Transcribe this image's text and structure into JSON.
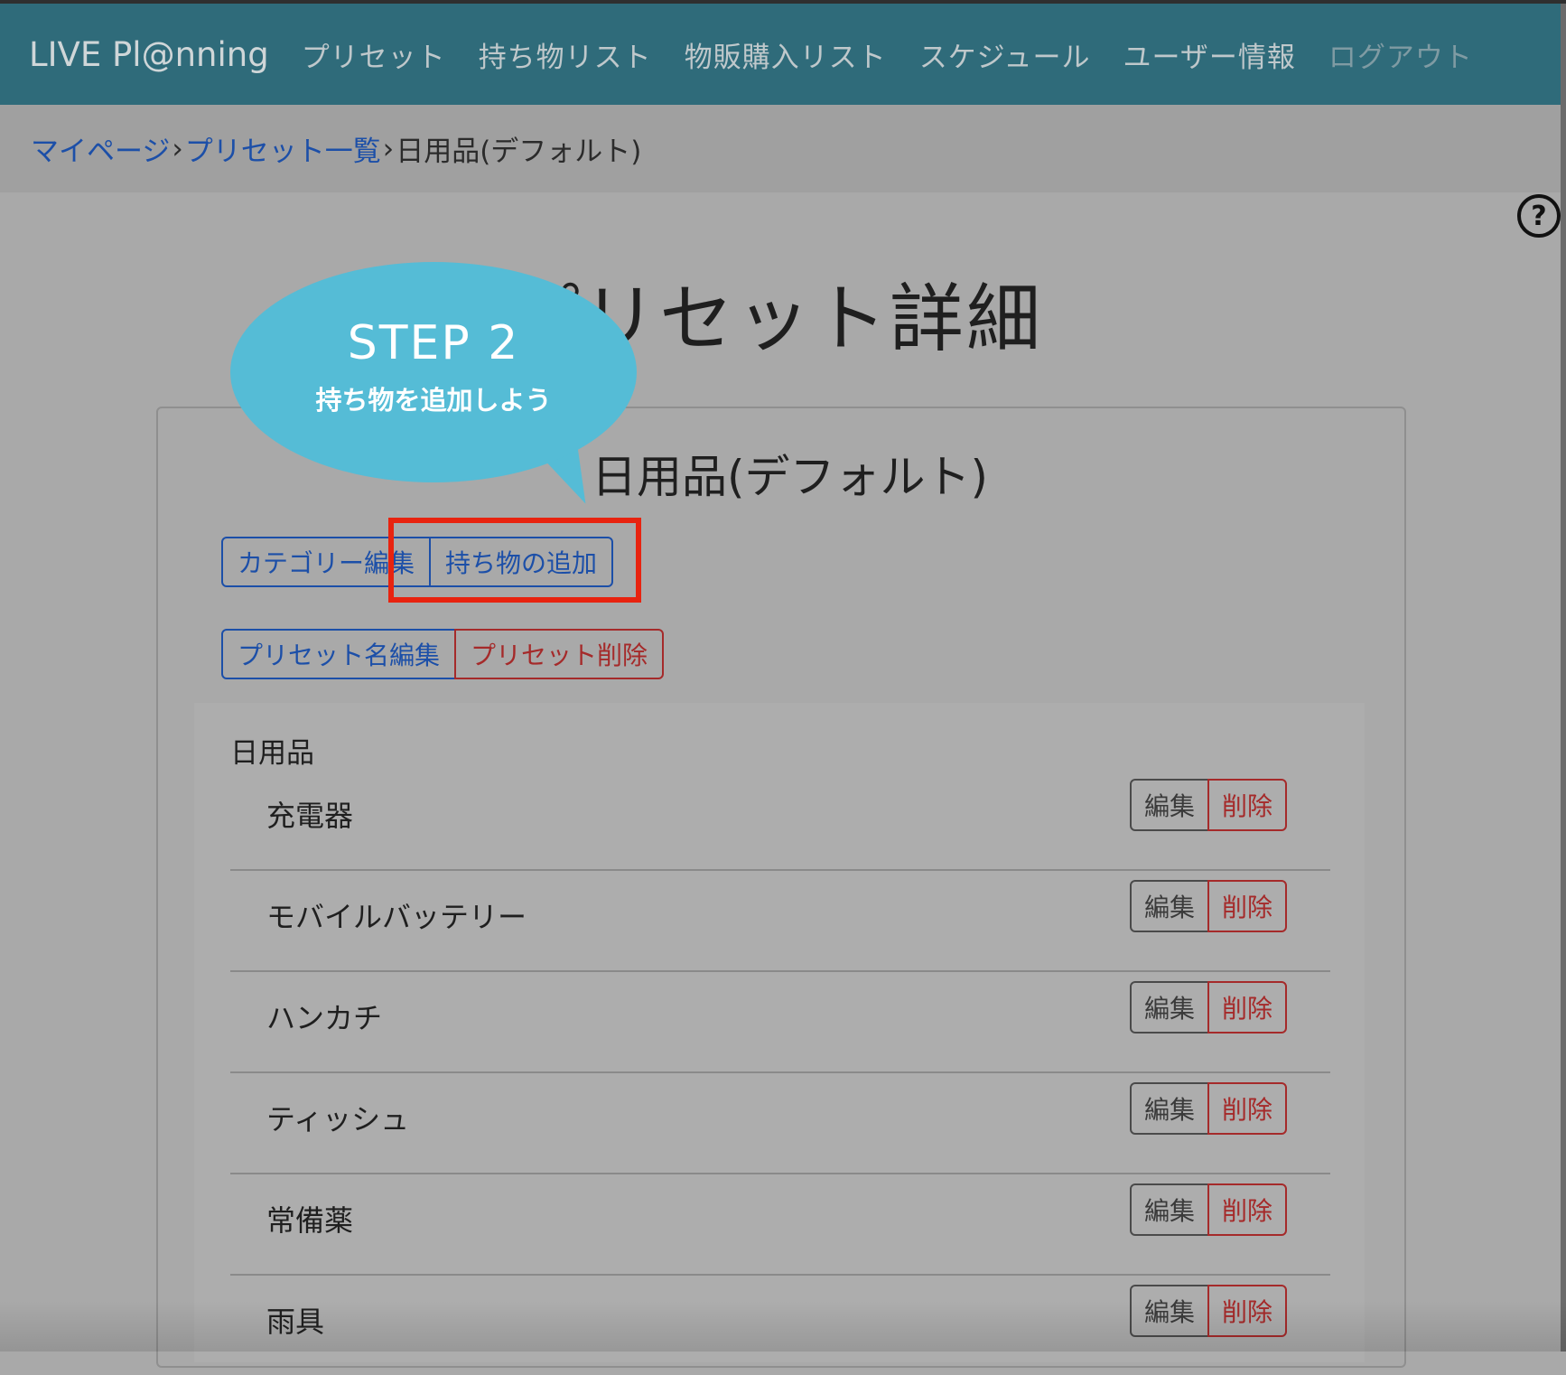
{
  "navbar": {
    "brand": "LIVE Pl@nning",
    "items": [
      {
        "label": "プリセット"
      },
      {
        "label": "持ち物リスト"
      },
      {
        "label": "物販購入リスト"
      },
      {
        "label": "スケジュール"
      },
      {
        "label": "ユーザー情報"
      },
      {
        "label": "ログアウト"
      }
    ]
  },
  "breadcrumb": {
    "mypage": "マイページ",
    "separator": "›",
    "preset_list": "プリセット一覧",
    "current": "日用品(デフォルト)"
  },
  "help": {
    "icon": "question-circle-icon",
    "glyph": "?"
  },
  "page": {
    "title": "プリセット詳細"
  },
  "tutorial": {
    "step": "STEP 2",
    "message": "持ち物を追加しよう",
    "bubble_color": "#55bcd6",
    "highlight_color": "#e8230f"
  },
  "preset": {
    "name": "日用品(デフォルト)",
    "buttons": {
      "edit_category": "カテゴリー編集",
      "add_item": "持ち物の追加",
      "rename_preset": "プリセット名編集",
      "delete_preset": "プリセット削除"
    }
  },
  "category": {
    "name": "日用品",
    "items": [
      {
        "name": "充電器",
        "edit": "編集",
        "delete": "削除"
      },
      {
        "name": "モバイルバッテリー",
        "edit": "編集",
        "delete": "削除"
      },
      {
        "name": "ハンカチ",
        "edit": "編集",
        "delete": "削除"
      },
      {
        "name": "ティッシュ",
        "edit": "編集",
        "delete": "削除"
      },
      {
        "name": "常備薬",
        "edit": "編集",
        "delete": "削除"
      },
      {
        "name": "雨具",
        "edit": "編集",
        "delete": "削除"
      }
    ]
  },
  "colors": {
    "navbar": "#2f6b7a",
    "link": "#1c4fa8",
    "danger": "#a52a2a",
    "overlay": "#a9a9a9"
  }
}
